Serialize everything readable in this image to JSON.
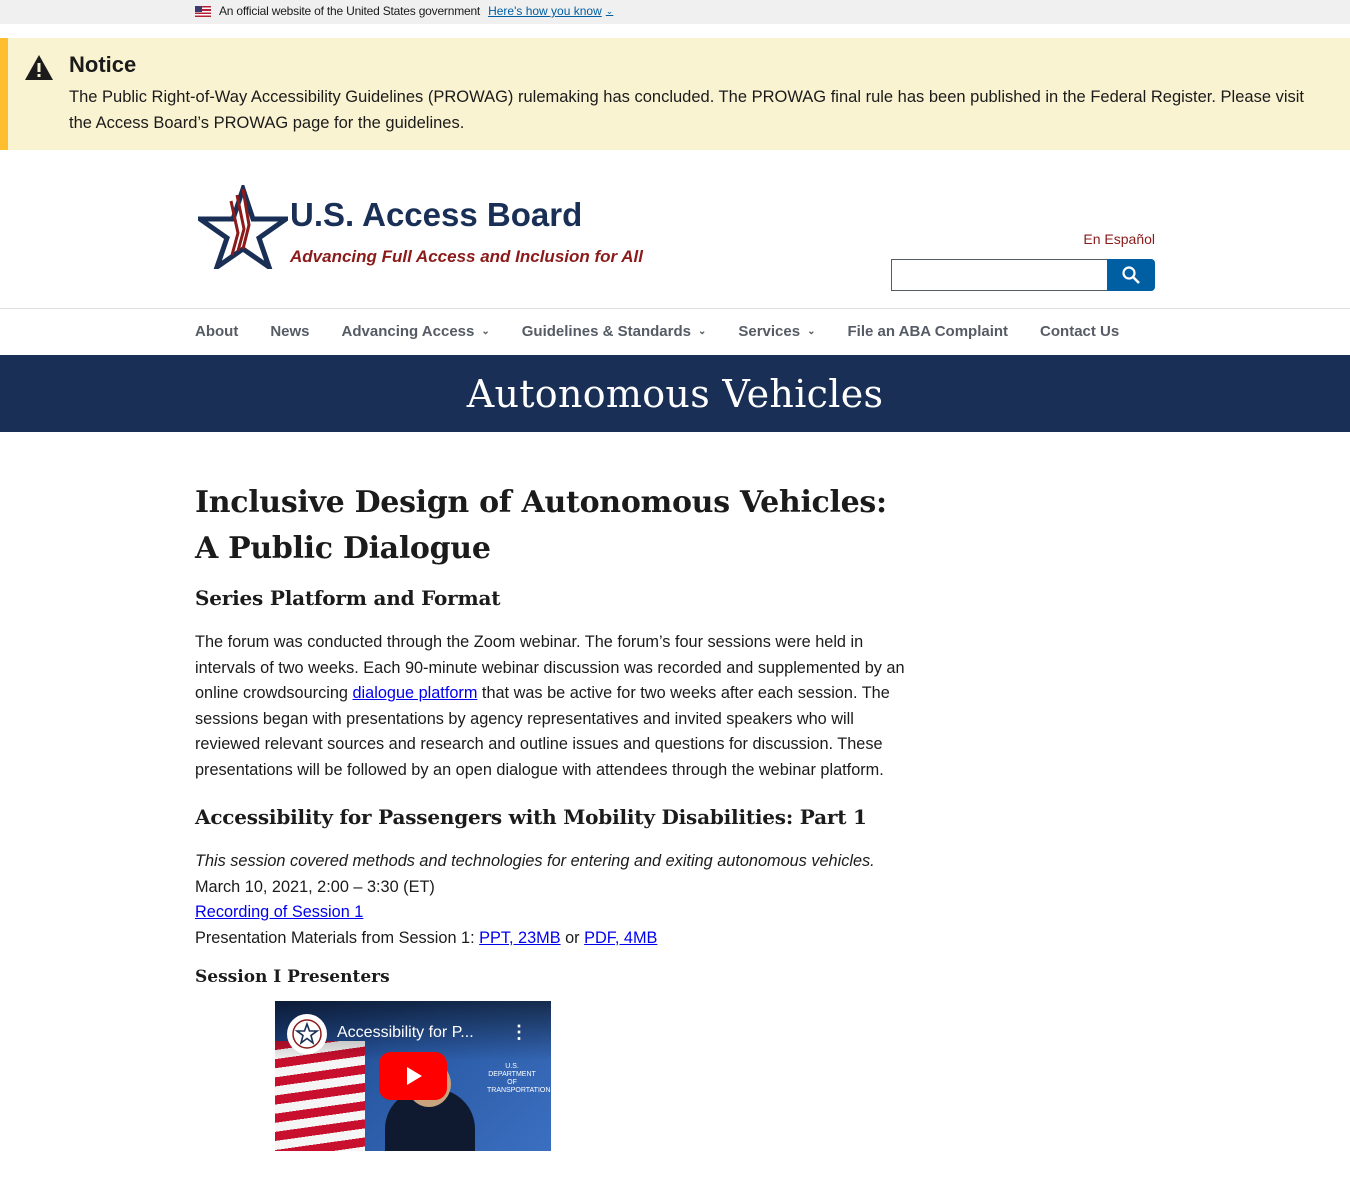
{
  "gov_banner": {
    "text": "An official website of the United States government",
    "link": "Here's how you know"
  },
  "notice": {
    "title": "Notice",
    "body": "The Public Right-of-Way Accessibility Guidelines (PROWAG) rulemaking has concluded. The PROWAG final rule has been published in the Federal Register. Please visit the Access Board’s PROWAG page for the guidelines."
  },
  "header": {
    "site_title": "U.S. Access Board",
    "tagline": "Advancing Full Access and Inclusion for All",
    "espanol": "En Español",
    "search_placeholder": ""
  },
  "nav": {
    "items": [
      {
        "label": "About",
        "dropdown": false
      },
      {
        "label": "News",
        "dropdown": false
      },
      {
        "label": "Advancing Access",
        "dropdown": true
      },
      {
        "label": "Guidelines & Standards",
        "dropdown": true
      },
      {
        "label": "Services",
        "dropdown": true
      },
      {
        "label": "File an ABA Complaint",
        "dropdown": false
      },
      {
        "label": "Contact Us",
        "dropdown": false
      }
    ]
  },
  "hero": {
    "title": "Autonomous Vehicles"
  },
  "main": {
    "heading": "Inclusive Design of Autonomous Vehicles: A Public Dialogue",
    "subheading": "Series Platform and Format",
    "para_before_link": "The forum was conducted through the Zoom webinar.  The forum’s four sessions were held in intervals of two weeks.  Each 90-minute webinar discussion was recorded and supplemented by an online crowdsourcing ",
    "para_link": "dialogue platform",
    "para_after_link": " that was be active for two weeks after each session.  The sessions began with presentations by agency representatives and invited speakers who will reviewed relevant sources and research and outline issues and questions for discussion.  These presentations will be followed by an open dialogue with attendees through the webinar platform.",
    "session_heading": "Accessibility for Passengers with Mobility Disabilities:  Part 1",
    "session_desc": "This session covered methods and technologies for entering and exiting autonomous vehicles.",
    "session_date": "March 10, 2021, 2:00 – 3:30 (ET)",
    "recording_link": "Recording of Session 1",
    "materials_label": "Presentation Materials from Session 1:  ",
    "ppt_link": "PPT, 23MB",
    "or_text": " or ",
    "pdf_link": "PDF, 4MB",
    "presenters_heading": "Session I Presenters"
  },
  "video": {
    "title": "Accessibility for P...",
    "menu": "⋮",
    "corner_logo": "U.S. DEPARTMENT OF TRANSPORTATION"
  },
  "colors": {
    "navy": "#1a2f56",
    "crimson": "#8b1a1a",
    "notice_bg": "#faf3d1",
    "notice_accent": "#ffbe2e",
    "search_blue": "#005ea2"
  }
}
